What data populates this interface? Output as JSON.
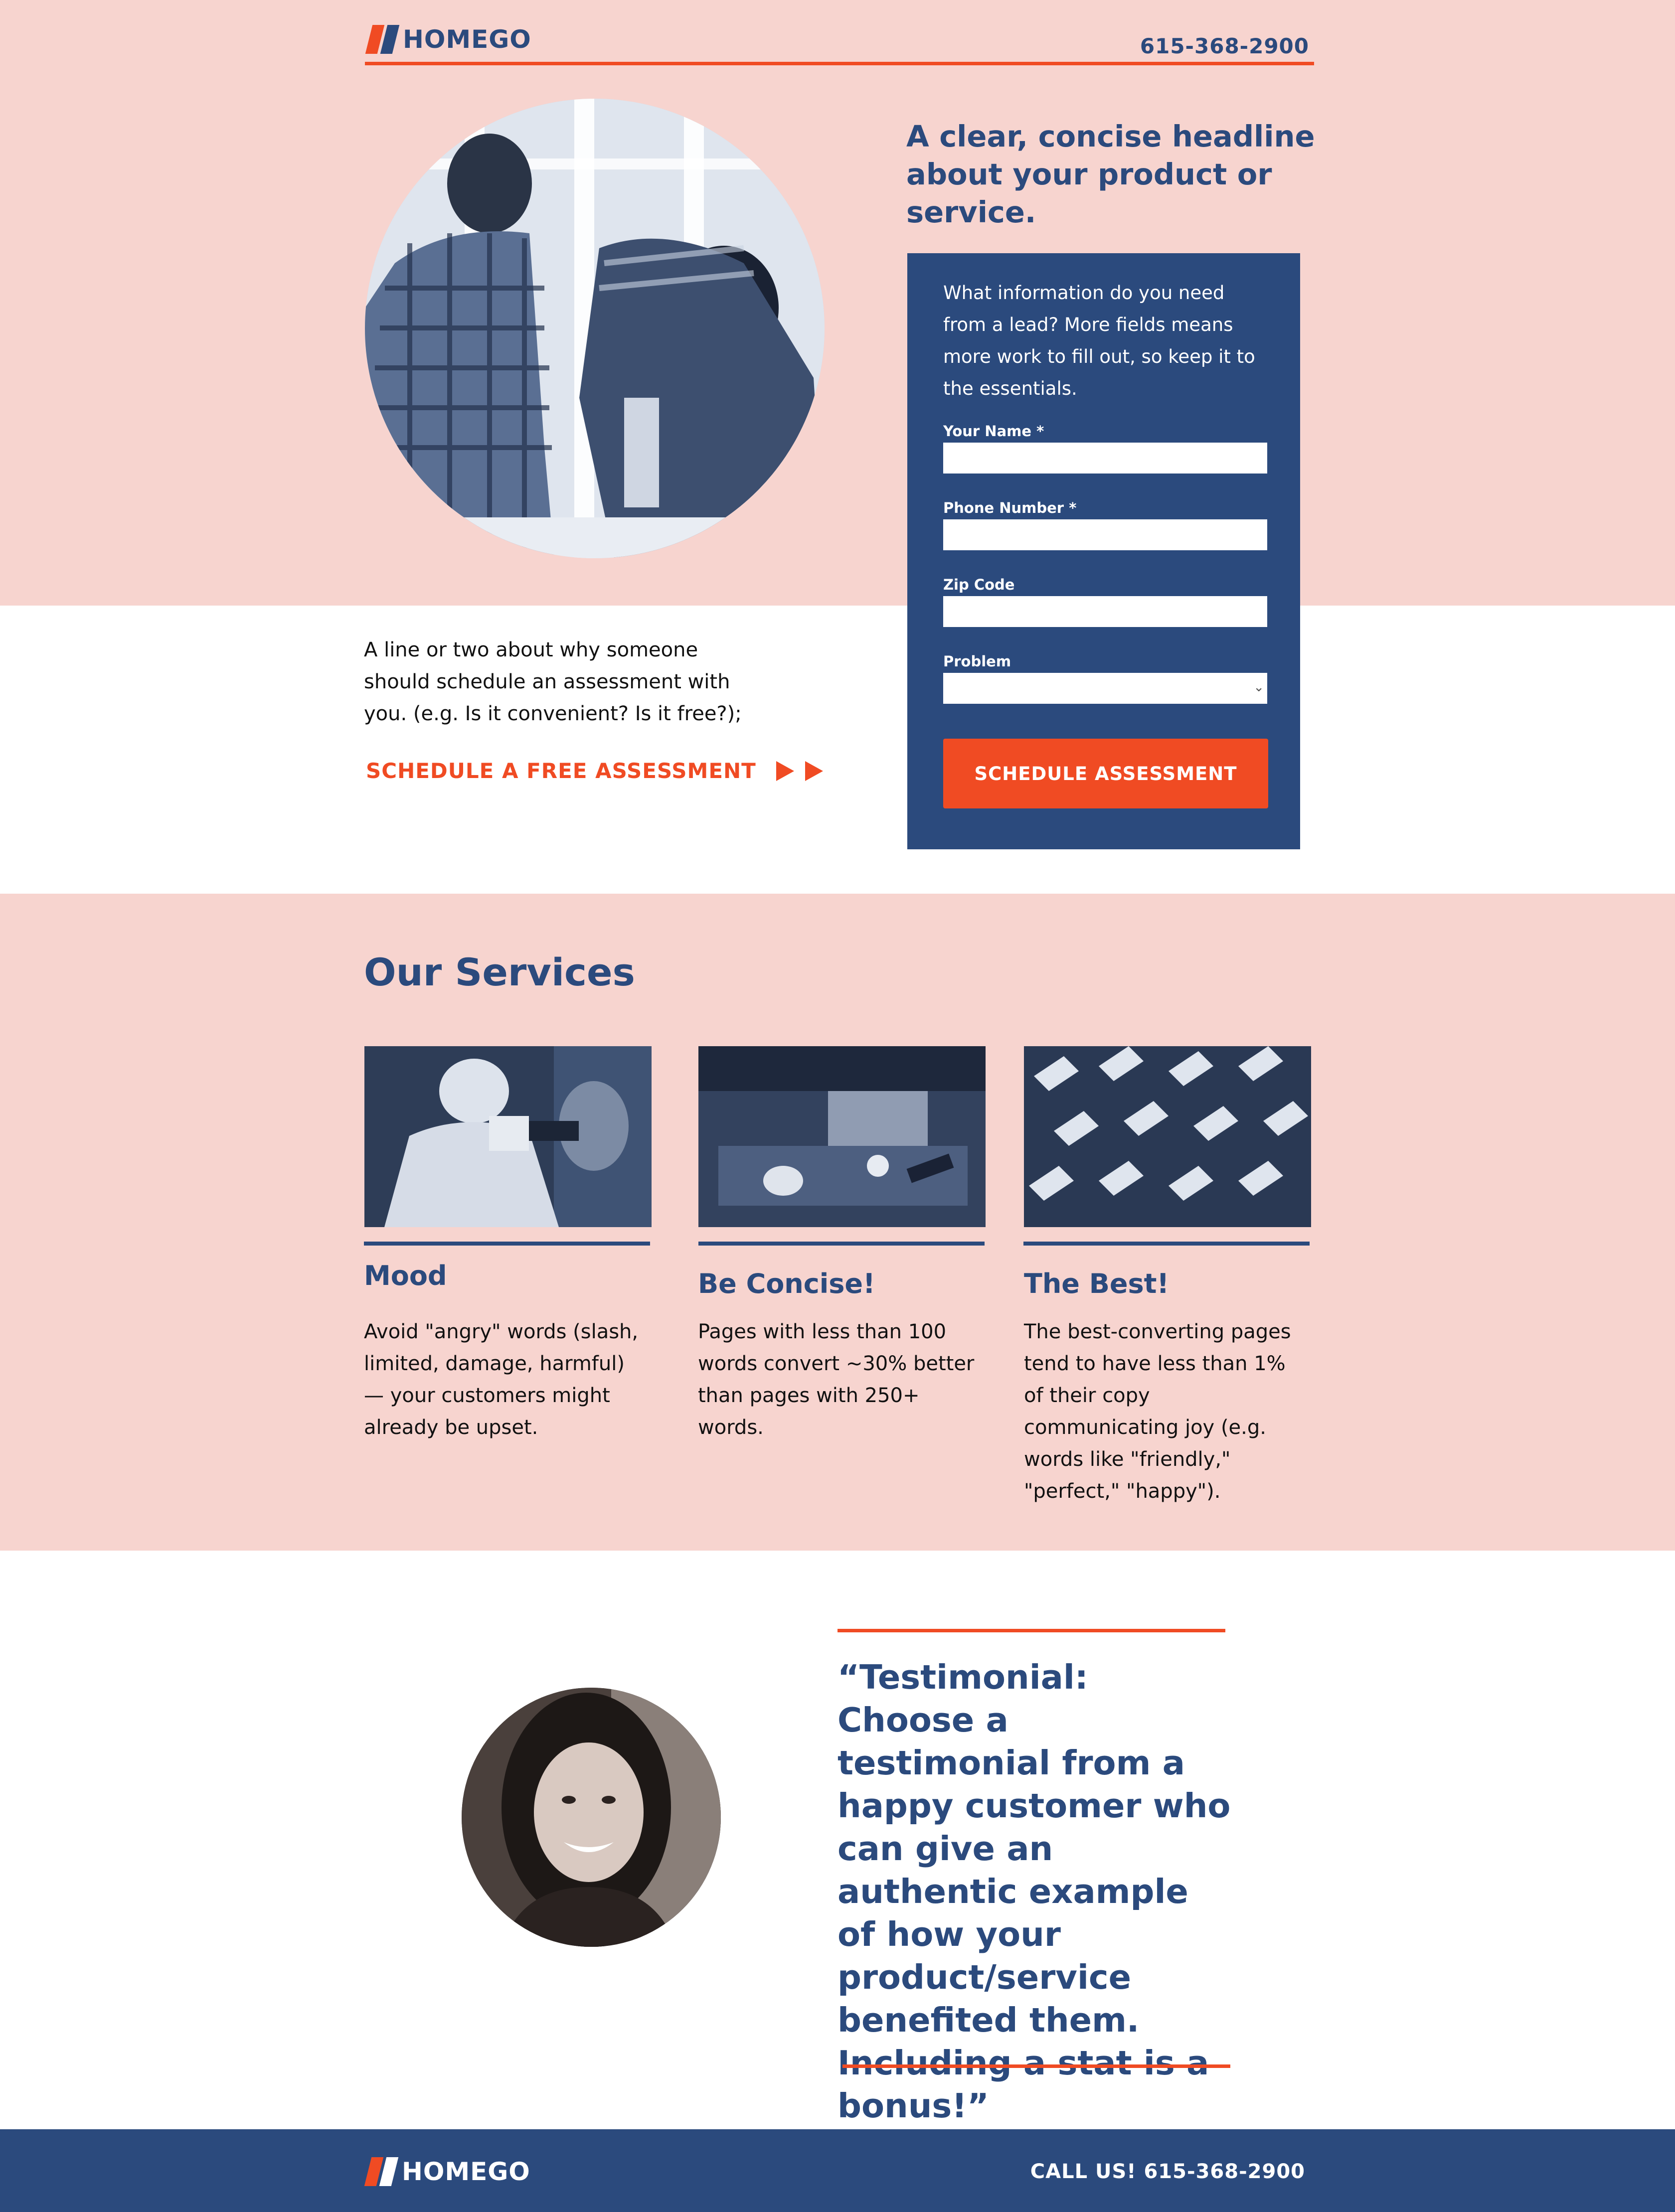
{
  "brand": {
    "name": "HOMEGO",
    "accent_color": "#f04b23",
    "primary_color": "#2b4a7d",
    "background_tint": "#f7d4cf"
  },
  "header": {
    "phone": "615-368-2900"
  },
  "hero": {
    "image_icon": "photo-two-workers-drilling",
    "headline": "A clear, concise headline about your product or service."
  },
  "form": {
    "intro": "What information do you need from a lead? More fields means more work to fill out, so keep it to the essentials.",
    "fields": [
      {
        "label": "Your Name *",
        "value": ""
      },
      {
        "label": "Phone Number *",
        "value": ""
      },
      {
        "label": "Zip Code",
        "value": ""
      },
      {
        "label": "Problem",
        "value": ""
      }
    ],
    "submit_label": "SCHEDULE ASSESSMENT"
  },
  "intro": {
    "text": "A line or two about why someone should schedule an assessment with you. (e.g. Is it convenient? Is it free?);",
    "cta_label": "SCHEDULE A FREE ASSESSMENT"
  },
  "services": {
    "title": "Our Services",
    "items": [
      {
        "image_icon": "photo-spray-painter",
        "title": "Mood",
        "text": "Avoid \"angry\" words (slash, limited, damage, harmful) — your customers might already be upset."
      },
      {
        "image_icon": "photo-workbench-tools",
        "title": "Be Concise!",
        "text": "Pages with less than 100 words convert ~30% better than pages with 250+ words."
      },
      {
        "image_icon": "photo-aerial-houses",
        "title": "The Best!",
        "text": "The best-converting pages tend to have less than 1% of their copy communicating joy (e.g. words like \"friendly,\" \"perfect,\" \"happy\")."
      }
    ]
  },
  "testimonial": {
    "image_icon": "photo-smiling-woman",
    "quote": "“Testimonial: Choose a testimonial from a happy customer who can give an authentic example of how your product/service benefited them. Including a stat is a bonus!”"
  },
  "footer": {
    "call_label": "CALL US! 615-368-2900"
  }
}
